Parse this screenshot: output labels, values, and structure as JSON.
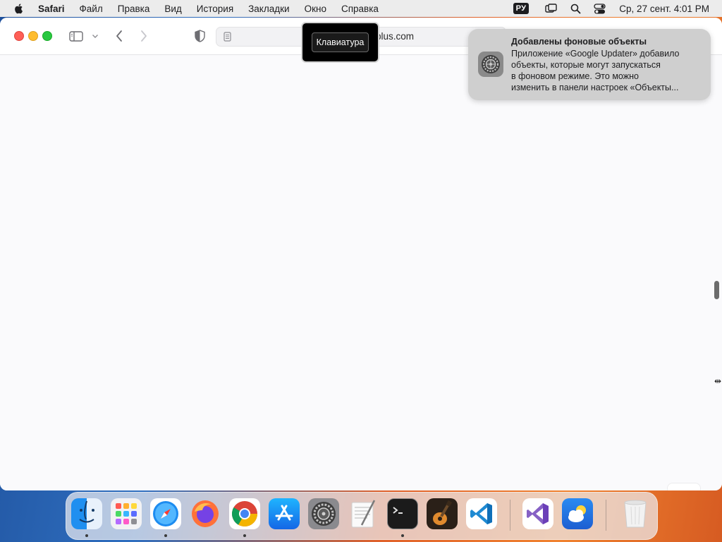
{
  "menubar": {
    "items": [
      {
        "label": "Safari"
      },
      {
        "label": "Файл"
      },
      {
        "label": "Правка"
      },
      {
        "label": "Вид"
      },
      {
        "label": "История"
      },
      {
        "label": "Закладки"
      },
      {
        "label": "Окно"
      },
      {
        "label": "Справка"
      }
    ],
    "input_language": "РУ",
    "clock": "Ср, 27 сент.  4:01 PM"
  },
  "browser": {
    "url_visible_fragment": "plus.com"
  },
  "keyboard_overlay": {
    "label": "Клавиатура"
  },
  "notification": {
    "title": "Добавлены фоновые объекты",
    "body_lines": [
      "Приложение «Google Updater» добавило",
      "объекты, которые могут запускаться",
      "в фоновом режиме. Это можно",
      "изменить в панели настроек «Объекты..."
    ],
    "icon": "system-settings-gear-icon"
  },
  "dock": {
    "apps": [
      {
        "name": "finder",
        "running": true
      },
      {
        "name": "launchpad",
        "running": false
      },
      {
        "name": "safari",
        "running": true
      },
      {
        "name": "firefox",
        "running": false
      },
      {
        "name": "chrome",
        "running": true
      },
      {
        "name": "app-store",
        "running": false
      },
      {
        "name": "system-settings",
        "running": false
      },
      {
        "name": "textedit",
        "running": false
      },
      {
        "name": "terminal",
        "running": true
      },
      {
        "name": "garageband",
        "running": false
      },
      {
        "name": "vscode",
        "running": false
      },
      {
        "name": "visual-studio",
        "running": false
      },
      {
        "name": "weather",
        "running": false
      },
      {
        "name": "trash",
        "running": false
      }
    ]
  },
  "colors": {
    "traffic_red": "#fe5f57",
    "traffic_yellow": "#febc2e",
    "traffic_green": "#28c840"
  }
}
